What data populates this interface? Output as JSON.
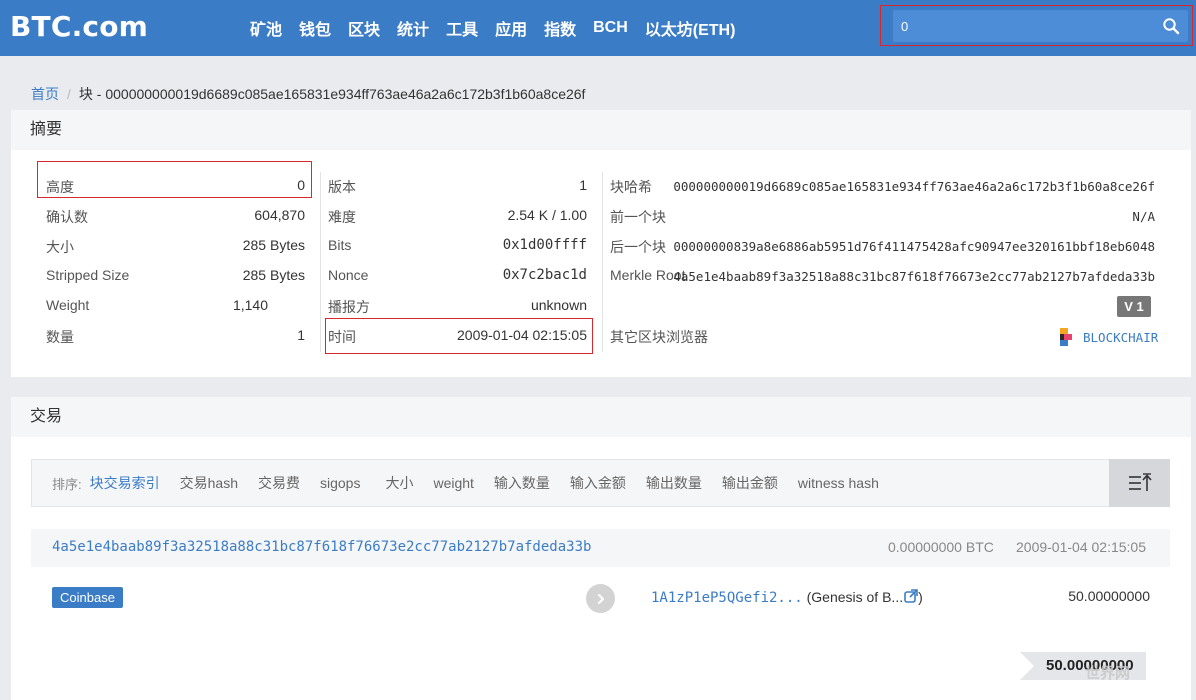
{
  "nav": {
    "logo": "BTC.com",
    "items": [
      "矿池",
      "钱包",
      "区块",
      "统计",
      "工具",
      "应用",
      "指数",
      "BCH",
      "以太坊(ETH)"
    ],
    "search_value": "0"
  },
  "breadcrumb": {
    "home": "首页",
    "separator": "/",
    "current": "块 - 000000000019d6689c085ae165831e934ff763ae46a2a6c172b3f1b60a8ce26f"
  },
  "summary": {
    "title": "摘要",
    "col1": [
      {
        "k": "高度",
        "v": "0"
      },
      {
        "k": "确认数",
        "v": "604,870"
      },
      {
        "k": "大小",
        "v": "285 Bytes"
      },
      {
        "k": "Stripped Size",
        "v": "285 Bytes"
      },
      {
        "k": "Weight",
        "v": "1,140"
      },
      {
        "k": "数量",
        "v": "1"
      }
    ],
    "col2": [
      {
        "k": "版本",
        "v": "1"
      },
      {
        "k": "难度",
        "v": "2.54 K / 1.00"
      },
      {
        "k": "Bits",
        "v": "0x1d00ffff"
      },
      {
        "k": "Nonce",
        "v": "0x7c2bac1d"
      },
      {
        "k": "播报方",
        "v": "unknown"
      },
      {
        "k": "时间",
        "v": "2009-01-04 02:15:05"
      }
    ],
    "col3": [
      {
        "k": "块哈希",
        "v": "000000000019d6689c085ae165831e934ff763ae46a2a6c172b3f1b60a8ce26f"
      },
      {
        "k": "前一个块",
        "v": "N/A"
      },
      {
        "k": "后一个块",
        "v": "00000000839a8e6886ab5951d76f411475428afc90947ee320161bbf18eb6048"
      },
      {
        "k": "Merkle Root",
        "v": "4a5e1e4baab89f3a32518a88c31bc87f618f76673e2cc77ab2127b7afdeda33b"
      }
    ],
    "version_badge": "V 1",
    "other_explorers_label": "其它区块浏览器",
    "other_explorer": "BLOCKCHAIR"
  },
  "transactions": {
    "title": "交易",
    "sort_prefix": "排序:",
    "sort_items": [
      "块交易索引",
      "交易hash",
      "交易费",
      "sigops",
      "大小",
      "weight",
      "输入数量",
      "输入金额",
      "输出数量",
      "输出金额",
      "witness hash"
    ],
    "tx": {
      "hash": "4a5e1e4baab89f3a32518a88c31bc87f618f76673e2cc77ab2127b7afdeda33b",
      "fee": "0.00000000 BTC",
      "time": "2009-01-04 02:15:05",
      "input_label": "Coinbase",
      "output_address": "1A1zP1eP5QGefi2...",
      "output_tag": "(Genesis of B...",
      "output_tag_close": ")",
      "output_amount": "50.00000000",
      "total": "50.00000000"
    }
  },
  "watermark": "世界网",
  "colors": {
    "brand": "#3b7cc6",
    "highlight": "#d9272e",
    "badge": "#777777"
  }
}
